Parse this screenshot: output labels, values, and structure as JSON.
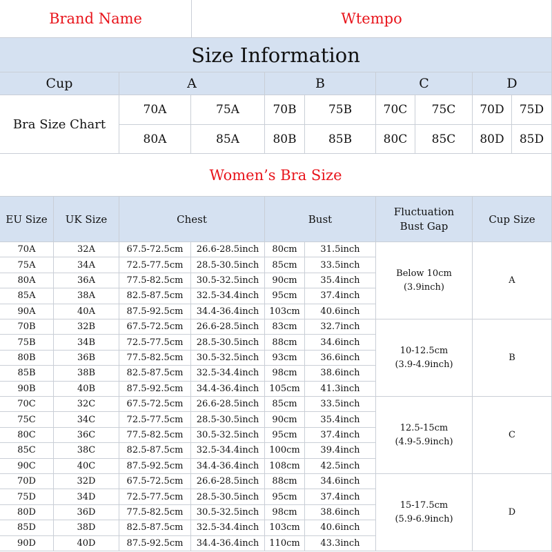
{
  "brand": {
    "label": "Brand Name",
    "value": "Wtempo"
  },
  "size_information": {
    "title": "Size Information"
  },
  "cup_row": {
    "label": "Cup",
    "cups": [
      "A",
      "B",
      "C",
      "D"
    ]
  },
  "bra_chart": {
    "label": "Bra Size Chart",
    "row1": [
      "70A",
      "75A",
      "70B",
      "75B",
      "70C",
      "75C",
      "70D",
      "75D"
    ],
    "row2": [
      "80A",
      "85A",
      "80B",
      "85B",
      "80C",
      "85C",
      "80D",
      "85D"
    ]
  },
  "womens_title": "Women’s Bra Size",
  "headers": {
    "eu": "EU Size",
    "uk": "UK Size",
    "chest": "Chest",
    "bust": "Bust",
    "fluct_line1": "Fluctuation",
    "fluct_line2": "Bust Gap",
    "cup_size": "Cup Size"
  },
  "groups": [
    {
      "cup": "A",
      "gap1": "Below 10cm",
      "gap2": "(3.9inch)",
      "rows": [
        [
          "70A",
          "32A",
          "67.5-72.5cm",
          "26.6-28.5inch",
          "80cm",
          "31.5inch"
        ],
        [
          "75A",
          "34A",
          "72.5-77.5cm",
          "28.5-30.5inch",
          "85cm",
          "33.5inch"
        ],
        [
          "80A",
          "36A",
          "77.5-82.5cm",
          "30.5-32.5inch",
          "90cm",
          "35.4inch"
        ],
        [
          "85A",
          "38A",
          "82.5-87.5cm",
          "32.5-34.4inch",
          "95cm",
          "37.4inch"
        ],
        [
          "90A",
          "40A",
          "87.5-92.5cm",
          "34.4-36.4inch",
          "103cm",
          "40.6inch"
        ]
      ]
    },
    {
      "cup": "B",
      "gap1": "10-12.5cm",
      "gap2": "(3.9-4.9inch)",
      "rows": [
        [
          "70B",
          "32B",
          "67.5-72.5cm",
          "26.6-28.5inch",
          "83cm",
          "32.7inch"
        ],
        [
          "75B",
          "34B",
          "72.5-77.5cm",
          "28.5-30.5inch",
          "88cm",
          "34.6inch"
        ],
        [
          "80B",
          "36B",
          "77.5-82.5cm",
          "30.5-32.5inch",
          "93cm",
          "36.6inch"
        ],
        [
          "85B",
          "38B",
          "82.5-87.5cm",
          "32.5-34.4inch",
          "98cm",
          "38.6inch"
        ],
        [
          "90B",
          "40B",
          "87.5-92.5cm",
          "34.4-36.4inch",
          "105cm",
          "41.3inch"
        ]
      ]
    },
    {
      "cup": "C",
      "gap1": "12.5-15cm",
      "gap2": "(4.9-5.9inch)",
      "rows": [
        [
          "70C",
          "32C",
          "67.5-72.5cm",
          "26.6-28.5inch",
          "85cm",
          "33.5inch"
        ],
        [
          "75C",
          "34C",
          "72.5-77.5cm",
          "28.5-30.5inch",
          "90cm",
          "35.4inch"
        ],
        [
          "80C",
          "36C",
          "77.5-82.5cm",
          "30.5-32.5inch",
          "95cm",
          "37.4inch"
        ],
        [
          "85C",
          "38C",
          "82.5-87.5cm",
          "32.5-34.4inch",
          "100cm",
          "39.4inch"
        ],
        [
          "90C",
          "40C",
          "87.5-92.5cm",
          "34.4-36.4inch",
          "108cm",
          "42.5inch"
        ]
      ]
    },
    {
      "cup": "D",
      "gap1": "15-17.5cm",
      "gap2": "(5.9-6.9inch)",
      "rows": [
        [
          "70D",
          "32D",
          "67.5-72.5cm",
          "26.6-28.5inch",
          "88cm",
          "34.6inch"
        ],
        [
          "75D",
          "34D",
          "72.5-77.5cm",
          "28.5-30.5inch",
          "95cm",
          "37.4inch"
        ],
        [
          "80D",
          "36D",
          "77.5-82.5cm",
          "30.5-32.5inch",
          "98cm",
          "38.6inch"
        ],
        [
          "85D",
          "38D",
          "82.5-87.5cm",
          "32.5-34.4inch",
          "103cm",
          "40.6inch"
        ],
        [
          "90D",
          "40D",
          "87.5-92.5cm",
          "34.4-36.4inch",
          "110cm",
          "43.3inch"
        ]
      ]
    }
  ]
}
